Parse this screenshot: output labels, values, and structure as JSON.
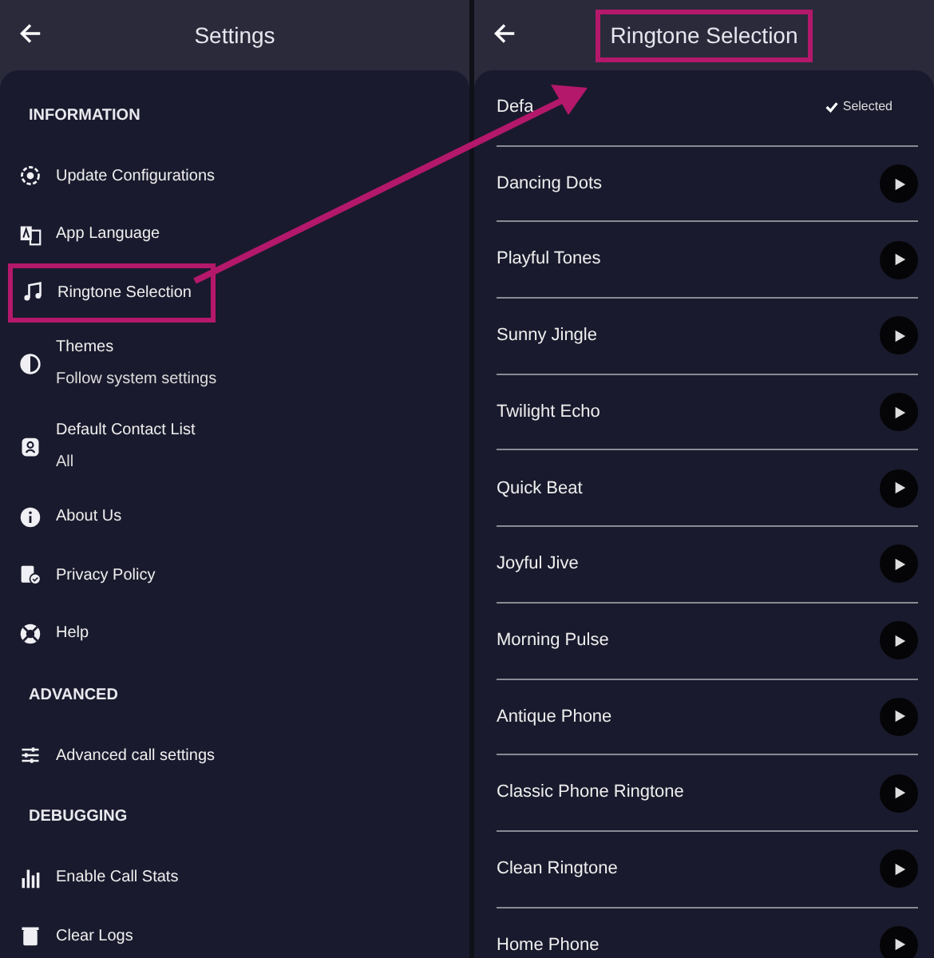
{
  "settings": {
    "title": "Settings",
    "items": [
      {
        "kind": "header",
        "label": "INFORMATION"
      },
      {
        "kind": "item",
        "label": "Update Configurations",
        "highlighted": false
      },
      {
        "kind": "item",
        "label": "App Language",
        "highlighted": false
      },
      {
        "kind": "item",
        "label": "Ringtone Selection",
        "highlighted": true
      },
      {
        "kind": "item",
        "label": "Themes",
        "subtitle": "Follow system settings",
        "highlighted": false
      },
      {
        "kind": "item",
        "label": "Default Contact List",
        "subtitle": "All",
        "highlighted": false
      },
      {
        "kind": "item",
        "label": "About Us",
        "highlighted": false
      },
      {
        "kind": "item",
        "label": "Privacy Policy",
        "highlighted": false
      },
      {
        "kind": "item",
        "label": "Help",
        "highlighted": false
      },
      {
        "kind": "header",
        "label": "ADVANCED"
      },
      {
        "kind": "item",
        "label": "Advanced call settings",
        "highlighted": false
      },
      {
        "kind": "header",
        "label": "DEBUGGING"
      },
      {
        "kind": "item",
        "label": "Enable Call Stats",
        "highlighted": false
      },
      {
        "kind": "item",
        "label": "Clear Logs",
        "highlighted": false
      }
    ]
  },
  "ringtones": {
    "title": "Ringtone Selection",
    "title_highlighted": true,
    "items": [
      {
        "label": "Defa",
        "selected": true,
        "status": "Selected"
      },
      {
        "label": "Dancing Dots",
        "selected": false
      },
      {
        "label": "Playful Tones",
        "selected": false
      },
      {
        "label": "Sunny Jingle",
        "selected": false
      },
      {
        "label": "Twilight Echo",
        "selected": false
      },
      {
        "label": "Quick Beat",
        "selected": false
      },
      {
        "label": "Joyful Jive",
        "selected": false
      },
      {
        "label": "Morning Pulse",
        "selected": false
      },
      {
        "label": "Antique Phone",
        "selected": false
      },
      {
        "label": "Classic Phone Ringtone",
        "selected": false
      },
      {
        "label": "Clean Ringtone",
        "selected": false
      },
      {
        "label": "Home Phone",
        "selected": false
      }
    ]
  }
}
